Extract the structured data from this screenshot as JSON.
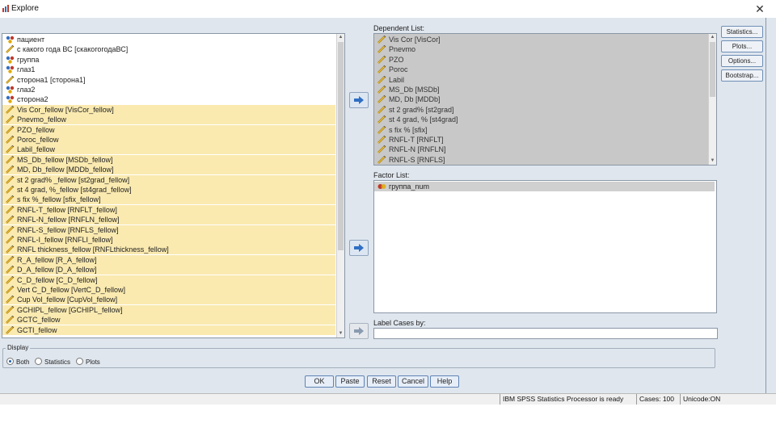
{
  "window": {
    "title": "Explore",
    "close_glyph": "✕"
  },
  "source_list": {
    "items": [
      {
        "label": "пациент",
        "icon": "nominal-icon",
        "selected": false
      },
      {
        "label": "с какого года ВС [скакогогодаВС]",
        "icon": "scale-icon",
        "selected": false
      },
      {
        "label": "группа",
        "icon": "nominal-icon",
        "selected": false
      },
      {
        "label": "глаз1",
        "icon": "nominal-icon",
        "selected": false
      },
      {
        "label": "сторона1 [сторона1]",
        "icon": "scale-icon",
        "selected": false
      },
      {
        "label": "глаз2",
        "icon": "nominal-icon",
        "selected": false
      },
      {
        "label": "сторона2",
        "icon": "nominal-icon",
        "selected": false
      },
      {
        "label": "Vis Cor_fellow [VisCor_fellow]",
        "icon": "scale-icon",
        "selected": true
      },
      {
        "label": "Pnevmo_fellow",
        "icon": "scale-icon",
        "selected": true
      },
      {
        "label": "PZO_fellow",
        "icon": "scale-icon",
        "selected": true
      },
      {
        "label": "Poroc_fellow",
        "icon": "scale-icon",
        "selected": true
      },
      {
        "label": "Labil_fellow",
        "icon": "scale-icon",
        "selected": true
      },
      {
        "label": "MS_Db_fellow [MSDb_fellow]",
        "icon": "scale-icon",
        "selected": true
      },
      {
        "label": "MD, Db_fellow [MDDb_fellow]",
        "icon": "scale-icon",
        "selected": true
      },
      {
        "label": "st 2 grad% _fellow [st2grad_fellow]",
        "icon": "scale-icon",
        "selected": true
      },
      {
        "label": "st 4 grad, %_fellow [st4grad_fellow]",
        "icon": "scale-icon",
        "selected": true
      },
      {
        "label": "s fix %_fellow [sfix_fellow]",
        "icon": "scale-icon",
        "selected": true
      },
      {
        "label": "RNFL-T_fellow [RNFLT_fellow]",
        "icon": "scale-icon",
        "selected": true
      },
      {
        "label": "RNFL-N_fellow [RNFLN_fellow]",
        "icon": "scale-icon",
        "selected": true
      },
      {
        "label": "RNFL-S_fellow [RNFLS_fellow]",
        "icon": "scale-icon",
        "selected": true
      },
      {
        "label": "RNFL-I_fellow [RNFLI_fellow]",
        "icon": "scale-icon",
        "selected": true
      },
      {
        "label": "RNFL thickness_fellow [RNFLthickness_fellow]",
        "icon": "scale-icon",
        "selected": true
      },
      {
        "label": "R_A_fellow [R_A_fellow]",
        "icon": "scale-icon",
        "selected": true
      },
      {
        "label": "D_A_fellow [D_A_fellow]",
        "icon": "scale-icon",
        "selected": true
      },
      {
        "label": "C_D_fellow [C_D_fellow]",
        "icon": "scale-icon",
        "selected": true
      },
      {
        "label": "Vert C_D_fellow [VertC_D_fellow]",
        "icon": "scale-icon",
        "selected": true
      },
      {
        "label": "Cup Vol_fellow [CupVol_fellow]",
        "icon": "scale-icon",
        "selected": true
      },
      {
        "label": "GCHIPL_fellow [GCHIPL_fellow]",
        "icon": "scale-icon",
        "selected": true
      },
      {
        "label": "GCTC_fellow",
        "icon": "scale-icon",
        "selected": true
      },
      {
        "label": "GCTI_fellow",
        "icon": "scale-icon",
        "selected": true
      }
    ]
  },
  "dependent_list": {
    "label": "Dependent List:",
    "items": [
      "Vis Cor [VisCor]",
      "Pnevmo",
      "PZO",
      "Poroc",
      "Labil",
      "MS_Db [MSDb]",
      "MD, Db [MDDb]",
      "st 2 grad% [st2grad]",
      "st 4 grad, % [st4grad]",
      "s fix % [sfix]",
      "RNFL-T [RNFLT]",
      "RNFL-N [RNFLN]",
      "RNFL-S [RNFLS]"
    ]
  },
  "factor_list": {
    "label": "Factor List:",
    "items": [
      "группа_num"
    ]
  },
  "label_cases": {
    "label": "Label Cases by:"
  },
  "side_buttons": [
    "Statistics...",
    "Plots...",
    "Options...",
    "Bootstrap..."
  ],
  "display": {
    "title": "Display",
    "options": [
      {
        "label": "Both",
        "checked": true
      },
      {
        "label": "Statistics",
        "checked": false
      },
      {
        "label": "Plots",
        "checked": false
      }
    ]
  },
  "bottom_buttons": [
    "OK",
    "Paste",
    "Reset",
    "Cancel",
    "Help"
  ],
  "status_bar": {
    "processor": "IBM SPSS Statistics Processor is ready",
    "cases": "Cases: 100",
    "unicode": "Unicode:ON"
  },
  "colors": {
    "selected_row": "#faeab0",
    "dialog_bg": "#dfe6ee",
    "list_gray": "#c8c8c8",
    "factor_sel": "#d0d0d0",
    "button_border": "#5f83b3"
  }
}
